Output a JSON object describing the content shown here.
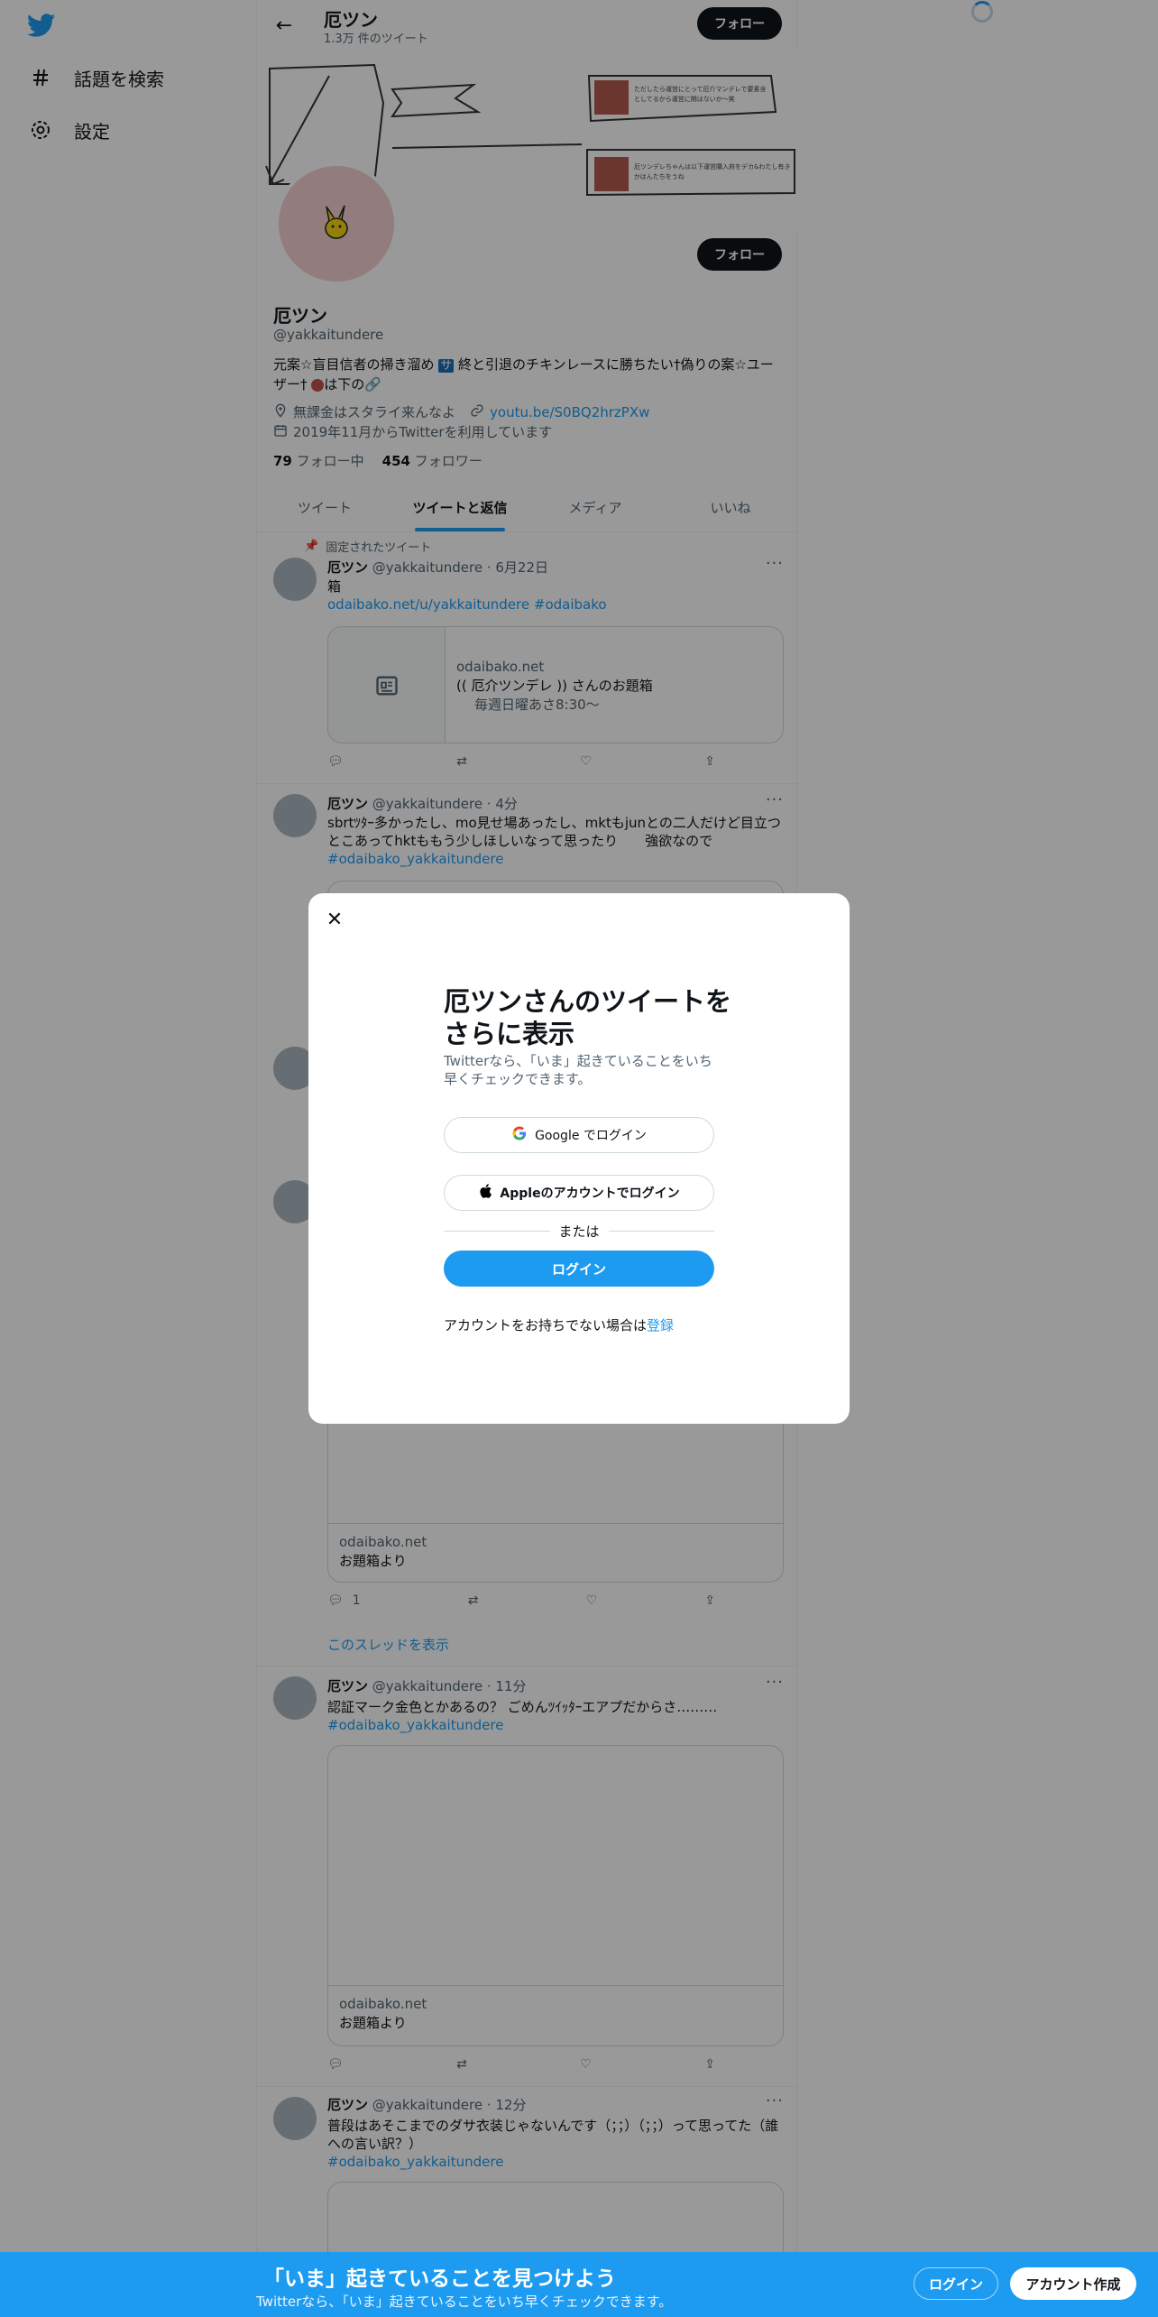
{
  "nav": {
    "explore_label": "話題を検索",
    "settings_label": "設定"
  },
  "header": {
    "name": "厄ツン",
    "tweet_count": "1.3万 件のツイート",
    "follow_label": "フォロー"
  },
  "banner": {
    "note1": "ただしたら運営にとって厄介マンデレで要素含としてるから運営に関はないか〜笑",
    "note2": "厄ツンデレちゃんは以下運営購入府をデカ&わたし有きかはんたちをうね"
  },
  "profile": {
    "name": "厄ツン",
    "handle": "@yakkaitundere",
    "bio_line1": "元案☆盲目信者の掃き溜め",
    "bio_badge": "サ",
    "bio_line1b": "終と引退のチキンレースに勝ちたい†偽りの案☆ユー",
    "bio_line2": "ザー† ",
    "bio_line2b": "は下の",
    "location": "無課金はスタライ来んなよ",
    "link": "youtu.be/S0BQ2hrzPXw",
    "joined": "2019年11月からTwitterを利用しています",
    "following_count": "79",
    "following_label": "フォロー中",
    "followers_count": "454",
    "followers_label": "フォロワー"
  },
  "tabs": [
    {
      "label": "ツイート"
    },
    {
      "label": "ツイートと返信"
    },
    {
      "label": "メディア"
    },
    {
      "label": "いいね"
    }
  ],
  "tweets": [
    {
      "pinned_label": "固定されたツイート",
      "name": "厄ツン",
      "handle": "@yakkaitundere",
      "time": "· 6月22日",
      "text": "箱",
      "link1": "odaibako.net/u/yakkaitundere",
      "link2": "#odaibako",
      "card_domain": "odaibako.net",
      "card_title": "(( 厄介ツンデレ )) さんのお題箱",
      "card_desc": "毎週日曜あさ8:30〜"
    },
    {
      "name": "厄ツン",
      "handle": "@yakkaitundere",
      "time": "· 4分",
      "text": "sbrtﾂﾀｰ多かったし、mo見せ場あったし、mktもjunとの二人だけど目立つとこあってhktももう少しほしいなって思ったり　　強欲なので",
      "hashtag": "#odaibako_yakkaitundere"
    },
    {
      "card_domain": "odaibako.net",
      "card_title": "お題箱より",
      "reply_count": "1",
      "show_thread": "このスレッドを表示"
    },
    {
      "name": "厄ツン",
      "handle": "@yakkaitundere",
      "time": "· 11分",
      "text": "認証マーク金色とかあるの？ ごめんﾂｲｯﾀｰエアプだからさ………",
      "hashtag": "#odaibako_yakkaitundere",
      "card_domain": "odaibako.net",
      "card_title": "お題箱より"
    },
    {
      "name": "厄ツン",
      "handle": "@yakkaitundere",
      "time": "· 12分",
      "text": "普段はあそこまでのダサ衣装じゃないんです（；；）（；；）って思ってた（誰への言い訳？）",
      "hashtag": "#odaibako_yakkaitundere"
    }
  ],
  "modal": {
    "title": "厄ツンさんのツイートをさらに表示",
    "subtitle": "Twitterなら、「いま」起きていることをいち早くチェックできます。",
    "google_label": "Google でログイン",
    "apple_label": "Appleのアカウントでログイン",
    "or_label": "または",
    "login_label": "ログイン",
    "signup_prefix": "アカウントをお持ちでない場合は",
    "signup_link": "登録"
  },
  "bottom_bar": {
    "title": "「いま」起きていることを見つけよう",
    "subtitle": "Twitterなら、「いま」起きていることをいち早くチェックできます。",
    "login_label": "ログイン",
    "signup_label": "アカウント作成"
  },
  "colors": {
    "accent": "#1d9bf0",
    "text": "#0f1419",
    "muted": "#536471"
  }
}
